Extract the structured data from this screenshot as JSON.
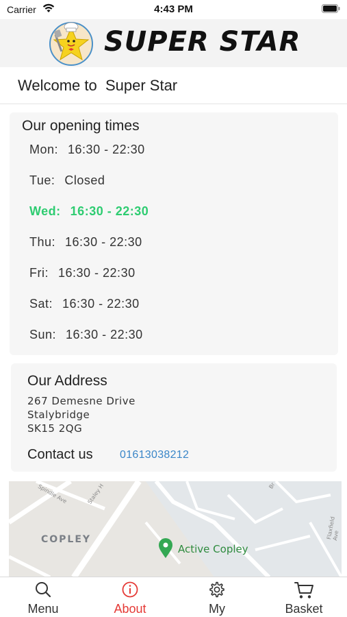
{
  "status_bar": {
    "carrier": "Carrier",
    "time": "4:43 PM"
  },
  "header": {
    "logo_text": "SUPER STAR"
  },
  "welcome": {
    "text": "Welcome to  Super Star"
  },
  "opening_times": {
    "title": "Our opening times",
    "rows": [
      {
        "day": "Mon:",
        "time": "16:30 - 22:30",
        "today": false
      },
      {
        "day": "Tue:",
        "time": "Closed",
        "today": false
      },
      {
        "day": "Wed:",
        "time": "16:30 - 22:30",
        "today": true
      },
      {
        "day": "Thu:",
        "time": "16:30 - 22:30",
        "today": false
      },
      {
        "day": "Fri:",
        "time": "16:30 - 22:30",
        "today": false
      },
      {
        "day": "Sat:",
        "time": "16:30 - 22:30",
        "today": false
      },
      {
        "day": "Sun:",
        "time": "16:30 - 22:30",
        "today": false
      }
    ],
    "today_color": "#2ecc71"
  },
  "address": {
    "title": "Our Address",
    "lines": [
      "267 Demesne Drive",
      "Stalybridge",
      "SK15 2QG"
    ],
    "contact_label": "Contact us",
    "phone": "01613038212",
    "link_color": "#3a86c8"
  },
  "map": {
    "area_label": "COPLEY",
    "place_label": "Active Copley",
    "streets": [
      "Spindle Ave",
      "Staley H",
      "Br",
      "Flaxfield Ave"
    ]
  },
  "tabs": [
    {
      "label": "Menu",
      "icon": "search-icon",
      "active": false
    },
    {
      "label": "About",
      "icon": "info-icon",
      "active": true
    },
    {
      "label": "My",
      "icon": "gear-icon",
      "active": false
    },
    {
      "label": "Basket",
      "icon": "cart-icon",
      "active": false
    }
  ],
  "accent_color": "#e53935"
}
